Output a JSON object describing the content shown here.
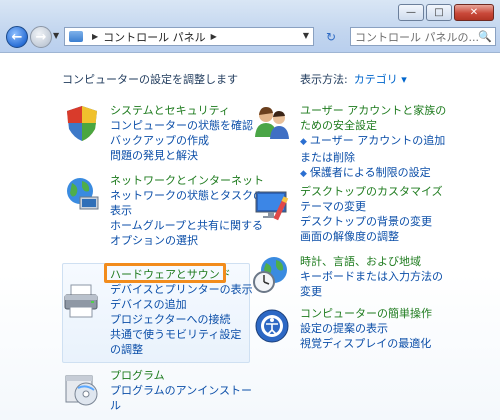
{
  "window": {
    "caption_buttons": [
      "—",
      "□",
      "✕"
    ]
  },
  "nav": {
    "back_icon": "back-arrow-icon",
    "forward_icon": "forward-arrow-icon",
    "address": {
      "root": "コントロール パネル"
    },
    "refresh_icon": "refresh-icon",
    "search_placeholder": "コントロール パネルの..."
  },
  "content": {
    "adjust_title": "コンピューターの設定を調整します",
    "view_by_label": "表示方法:",
    "view_by_value": "カテゴリ ▾"
  },
  "categories": [
    {
      "id": "system",
      "icon": "shield-system-icon",
      "title": "システムとセキュリティ",
      "links": [
        "コンピューターの状態を確認",
        "バックアップの作成",
        "問題の発見と解決"
      ]
    },
    {
      "id": "network",
      "icon": "network-globe-icon",
      "title": "ネットワークとインターネット",
      "links": [
        "ネットワークの状態とタスクの表示",
        "ホームグループと共有に関するオプションの選択"
      ]
    },
    {
      "id": "hardware",
      "icon": "printer-icon",
      "title": "ハードウェアとサウンド",
      "links": [
        "デバイスとプリンターの表示",
        "デバイスの追加",
        "プロジェクターへの接続",
        "共通で使うモビリティ設定の調整"
      ]
    },
    {
      "id": "programs",
      "icon": "programs-disc-icon",
      "title": "プログラム",
      "links": [
        "プログラムのアンインストール"
      ]
    },
    {
      "id": "users",
      "icon": "users-icon",
      "title": "ユーザー アカウントと家族のための安全設定",
      "links": [
        "ユーザー アカウントの追加または削除",
        "保護者による制限の設定"
      ]
    },
    {
      "id": "appearance",
      "icon": "desktop-paint-icon",
      "title": "デスクトップのカスタマイズ",
      "links": [
        "テーマの変更",
        "デスクトップの背景の変更",
        "画面の解像度の調整"
      ]
    },
    {
      "id": "clock",
      "icon": "clock-globe-icon",
      "title": "時計、言語、および地域",
      "links": [
        "キーボードまたは入力方法の変更"
      ]
    },
    {
      "id": "ease",
      "icon": "ease-of-access-icon",
      "title": "コンピューターの簡単操作",
      "links": [
        "設定の提案の表示",
        "視覚ディスプレイの最適化"
      ]
    }
  ]
}
